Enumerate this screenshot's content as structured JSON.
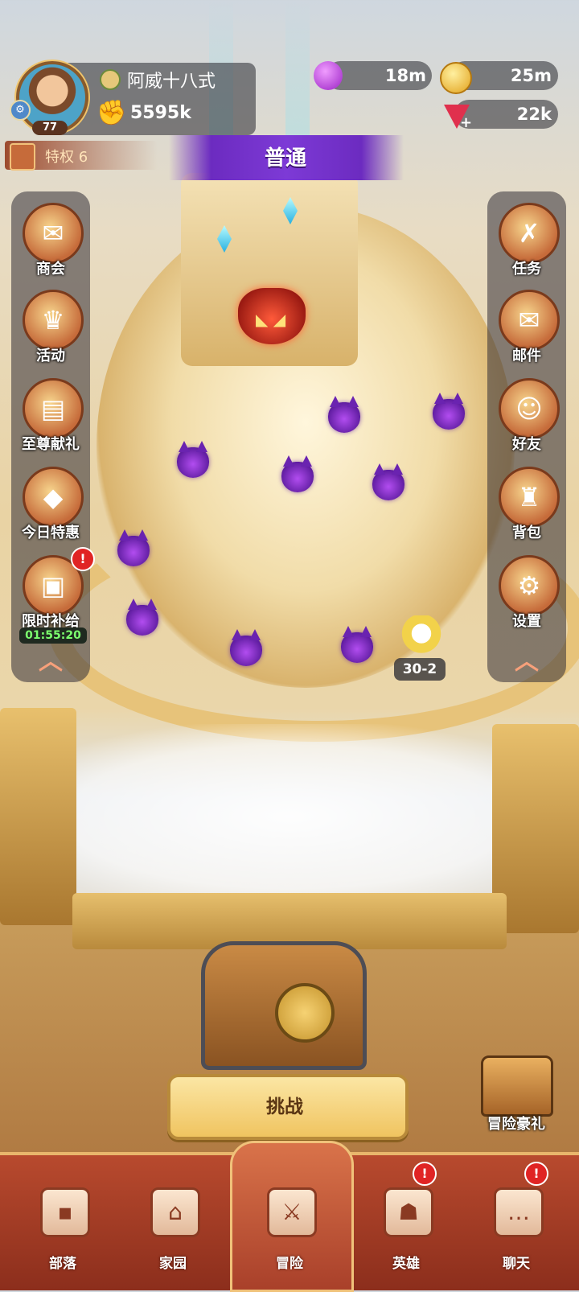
{
  "player": {
    "name": "阿威十八式",
    "level": "77",
    "power": "5595k",
    "privilege_label": "特权 6"
  },
  "resources": {
    "potion": "18m",
    "gold": "25m",
    "gems": "22k",
    "gem_plus": "+"
  },
  "mode": {
    "label": "普通"
  },
  "left_menu": [
    {
      "label": "商会",
      "icon": "treasure-bag-icon"
    },
    {
      "label": "活动",
      "icon": "gift-chest-icon"
    },
    {
      "label": "至尊献礼",
      "icon": "calendar-feather-icon"
    },
    {
      "label": "今日特惠",
      "icon": "gem-pouch-icon"
    },
    {
      "label": "限时补给",
      "icon": "supply-box-icon",
      "timer": "01:55:20",
      "alert": "!"
    }
  ],
  "right_menu": [
    {
      "label": "任务",
      "icon": "scroll-map-icon"
    },
    {
      "label": "邮件",
      "icon": "mail-envelope-icon"
    },
    {
      "label": "好友",
      "icon": "friends-icon"
    },
    {
      "label": "背包",
      "icon": "backpack-icon"
    },
    {
      "label": "设置",
      "icon": "gear-icon"
    }
  ],
  "collapse_glyph": "︿",
  "stage": {
    "current": "30-2"
  },
  "challenge_label": "挑战",
  "adventure_gift_label": "冒险豪礼",
  "nav": [
    {
      "label": "部落",
      "icon": "tribe-banner-icon",
      "glyph": "▪"
    },
    {
      "label": "家园",
      "icon": "home-icon",
      "glyph": "⌂"
    },
    {
      "label": "冒险",
      "icon": "crossed-swords-icon",
      "glyph": "⚔",
      "active": true
    },
    {
      "label": "英雄",
      "icon": "viking-helmet-icon",
      "glyph": "☗",
      "alert": "!"
    },
    {
      "label": "聊天",
      "icon": "chat-bubble-icon",
      "glyph": "…",
      "alert": "!"
    }
  ],
  "colors": {
    "accent_purple": "#7d3ad6",
    "nav_red": "#b84a2e",
    "button_gold": "#f0c460",
    "timer_green": "#7cff6e",
    "alert_red": "#e02424"
  }
}
